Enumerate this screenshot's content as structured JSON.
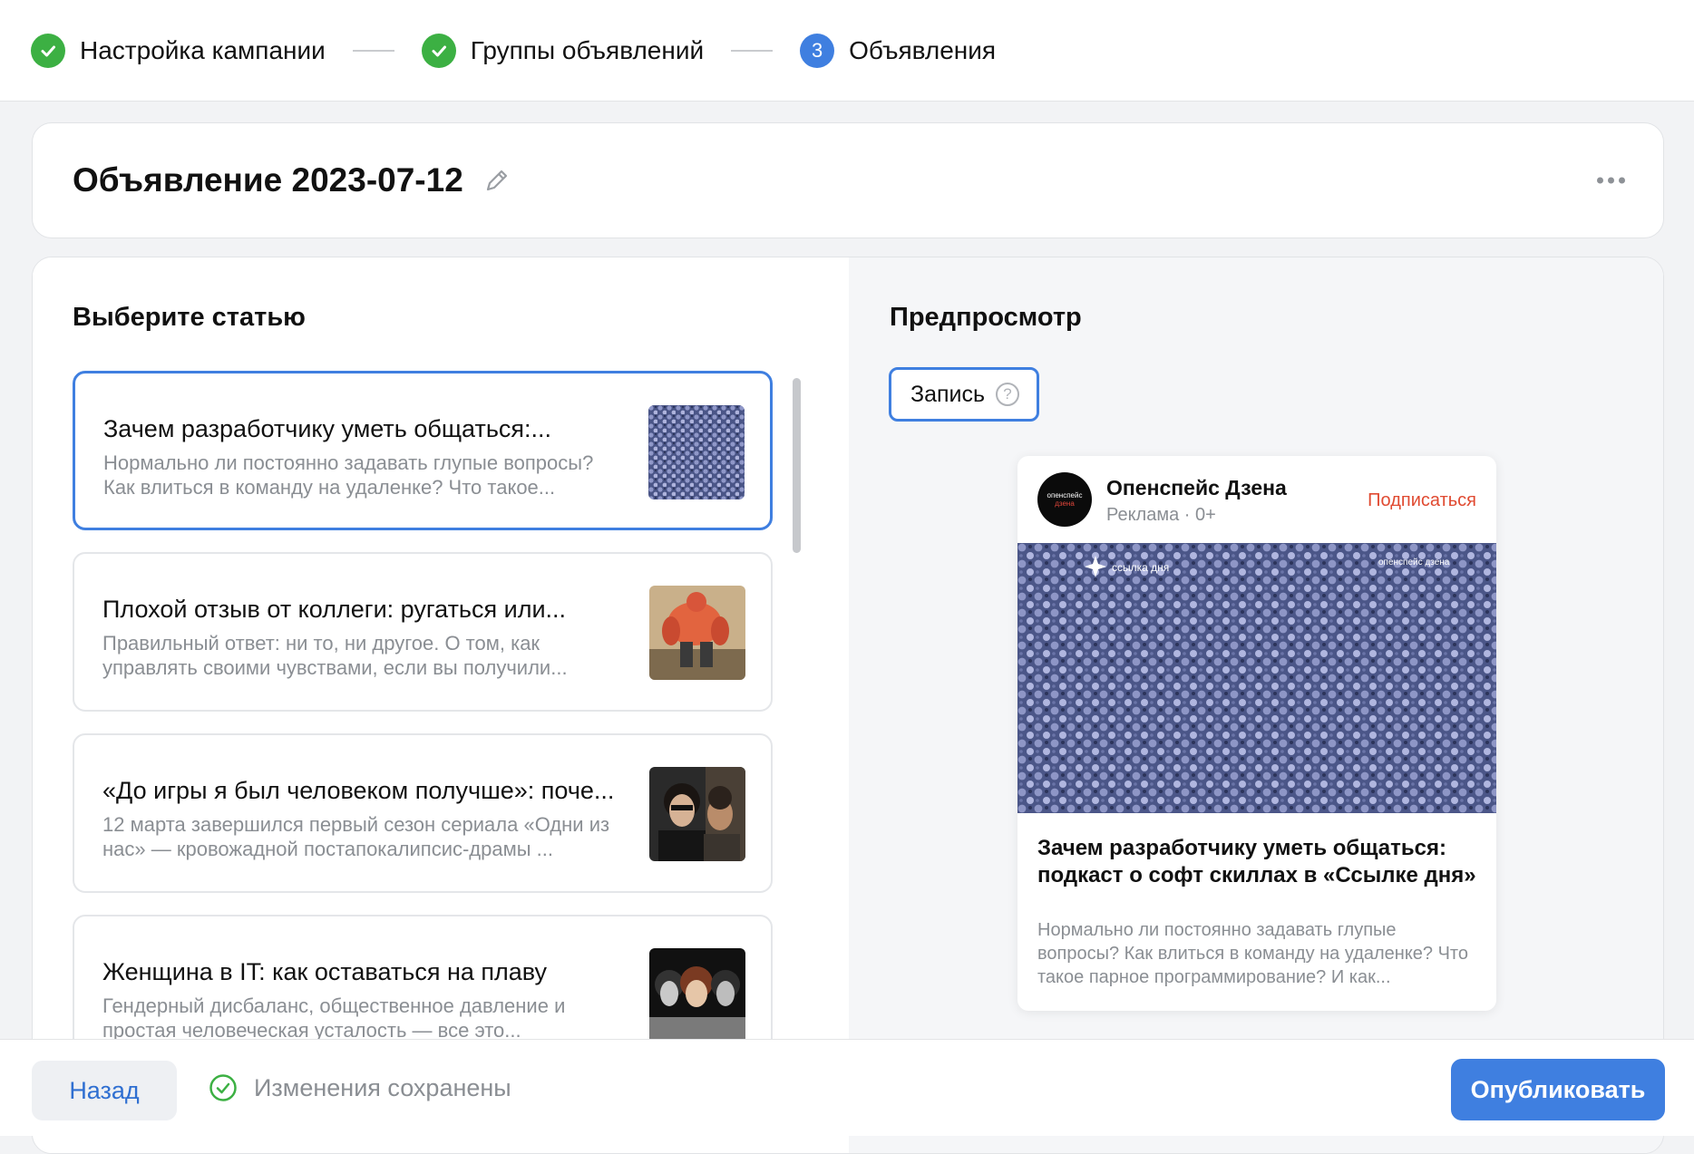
{
  "stepper": {
    "steps": [
      {
        "label": "Настройка кампании",
        "state": "done"
      },
      {
        "label": "Группы объявлений",
        "state": "done"
      },
      {
        "label": "Объявления",
        "state": "active",
        "number": "3"
      }
    ]
  },
  "ad": {
    "title": "Объявление 2023-07-12"
  },
  "select_article": {
    "title": "Выберите статью",
    "articles": [
      {
        "title": "Зачем разработчику уметь общаться:...",
        "description": "Нормально ли постоянно задавать глупые вопросы? Как влиться в команду на удаленке? Что такое...",
        "selected": true
      },
      {
        "title": "Плохой отзыв от коллеги: ругаться или...",
        "description": "Правильный ответ: ни то, ни другое. О том, как управлять своими чувствами, если вы получили...",
        "selected": false
      },
      {
        "title": "«До игры я был человеком получше»: поче...",
        "description": "12 марта завершился первый сезон сериала «Одни из нас» — кровожадной постапокалипсис-драмы ...",
        "selected": false
      },
      {
        "title": "Женщина в IT: как оставаться на плаву",
        "description": "Гендерный дисбаланс, общественное давление и простая человеческая усталость — все это...",
        "selected": false
      }
    ]
  },
  "preview": {
    "title": "Предпросмотр",
    "format_label": "Запись",
    "card": {
      "channel": "Опенспейс Дзена",
      "meta": "Реклама · 0+",
      "subscribe": "Подписаться",
      "avatar_text_1": "опенспейс",
      "avatar_text_2": "дзена",
      "image_watermark_left": "ссылка дня",
      "image_watermark_right": "опенспейс дзена",
      "title": "Зачем разработчику уметь общаться: подкаст о софт скиллах в «Ссылке дня»",
      "description": "Нормально ли постоянно задавать глупые вопросы? Как влиться в команду на удаленке? Что такое парное программирование? И как..."
    }
  },
  "bottom": {
    "back_label": "Назад",
    "saved_status": "Изменения сохранены",
    "publish_label": "Опубликовать"
  },
  "colors": {
    "accent": "#3f7fe0",
    "success": "#3cb043",
    "subscribe": "#e04a31"
  }
}
